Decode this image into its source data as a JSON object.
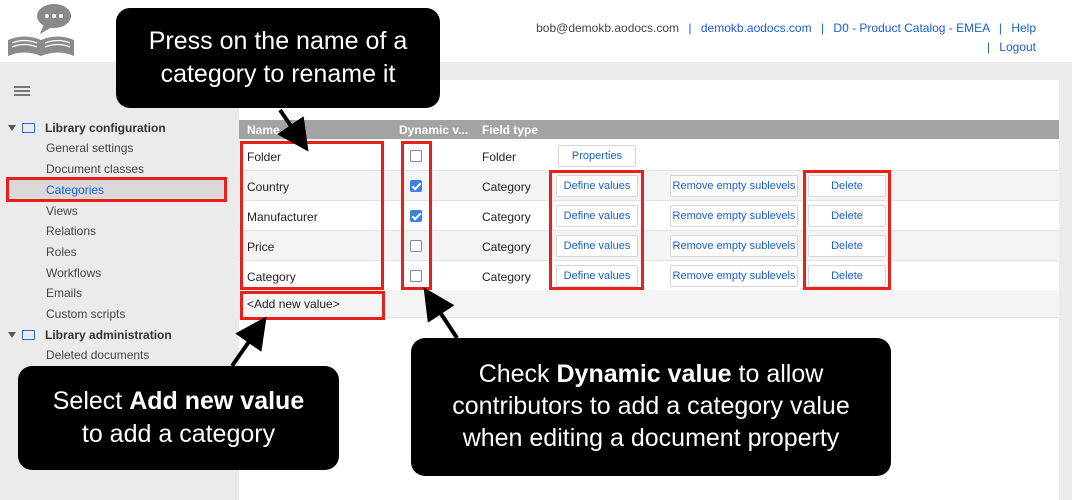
{
  "header": {
    "email": "bob@demokb.aodocs.com",
    "domain_link": "demokb.aodocs.com",
    "library_link": "D0 - Product Catalog - EMEA",
    "help_link": "Help",
    "logout_link": "Logout",
    "separator": "|"
  },
  "sidebar": {
    "groups": [
      {
        "label": "Library configuration",
        "items": [
          "General settings",
          "Document classes",
          "Categories",
          "Views",
          "Relations",
          "Roles",
          "Workflows",
          "Emails",
          "Custom scripts"
        ]
      },
      {
        "label": "Library administration",
        "items": [
          "Deleted documents"
        ]
      }
    ],
    "active_item": "Categories"
  },
  "table": {
    "columns": [
      "Name",
      "Dynamic v...",
      "Field type"
    ],
    "rows": [
      {
        "name": "Folder",
        "dynamic": false,
        "type": "Folder",
        "actions": [
          "Properties"
        ]
      },
      {
        "name": "Country",
        "dynamic": true,
        "type": "Category",
        "actions": [
          "Define values",
          "Remove empty sublevels",
          "Delete"
        ]
      },
      {
        "name": "Manufacturer",
        "dynamic": true,
        "type": "Category",
        "actions": [
          "Define values",
          "Remove empty sublevels",
          "Delete"
        ]
      },
      {
        "name": "Price",
        "dynamic": false,
        "type": "Category",
        "actions": [
          "Define values",
          "Remove empty sublevels",
          "Delete"
        ]
      },
      {
        "name": "Category",
        "dynamic": false,
        "type": "Category",
        "actions": [
          "Define values",
          "Remove empty sublevels",
          "Delete"
        ]
      }
    ],
    "add_new": "<Add new value>"
  },
  "callouts": {
    "rename": {
      "line1": "Press on the name of a",
      "line2": "category to rename it"
    },
    "add": {
      "pre": "Select ",
      "bold": "Add new value",
      "line2": "to add a category"
    },
    "dynamic": {
      "pre": "Check ",
      "bold": "Dynamic value",
      "post": " to allow",
      "line2": "contributors to add a category value",
      "line3": "when editing a document property"
    }
  },
  "colors": {
    "accent": "#1a5fd0",
    "annotation_red": "#e8201a",
    "header_gray": "#a3a3a3",
    "checkbox_blue": "#3b82e0"
  }
}
